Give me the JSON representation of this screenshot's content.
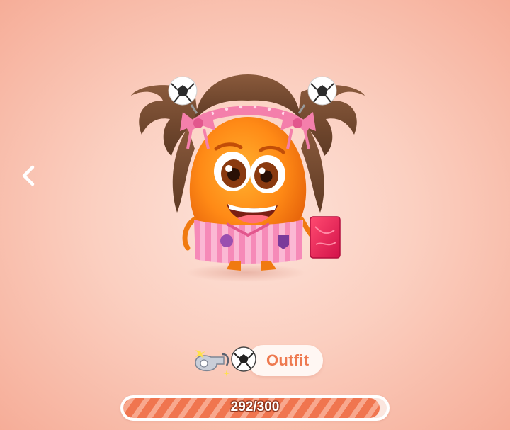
{
  "navigation": {
    "back_icon": "chevron-left-icon"
  },
  "avatar": {
    "icon": "orange-monster-avatar",
    "accessories": [
      "soccer-ball-hair-clips",
      "pink-bow-headband",
      "pink-striped-jersey",
      "red-card"
    ]
  },
  "outfit": {
    "label": "Outfit",
    "icons": [
      "whistle-icon",
      "soccer-ball-icon"
    ]
  },
  "progress": {
    "text": "292/300",
    "current": 292,
    "max": 300
  },
  "colors": {
    "accent": "#ee7a50",
    "bar_stripe_dark": "#f0754f",
    "bar_stripe_light": "#f8a88e",
    "background": "#fbcfc0"
  }
}
